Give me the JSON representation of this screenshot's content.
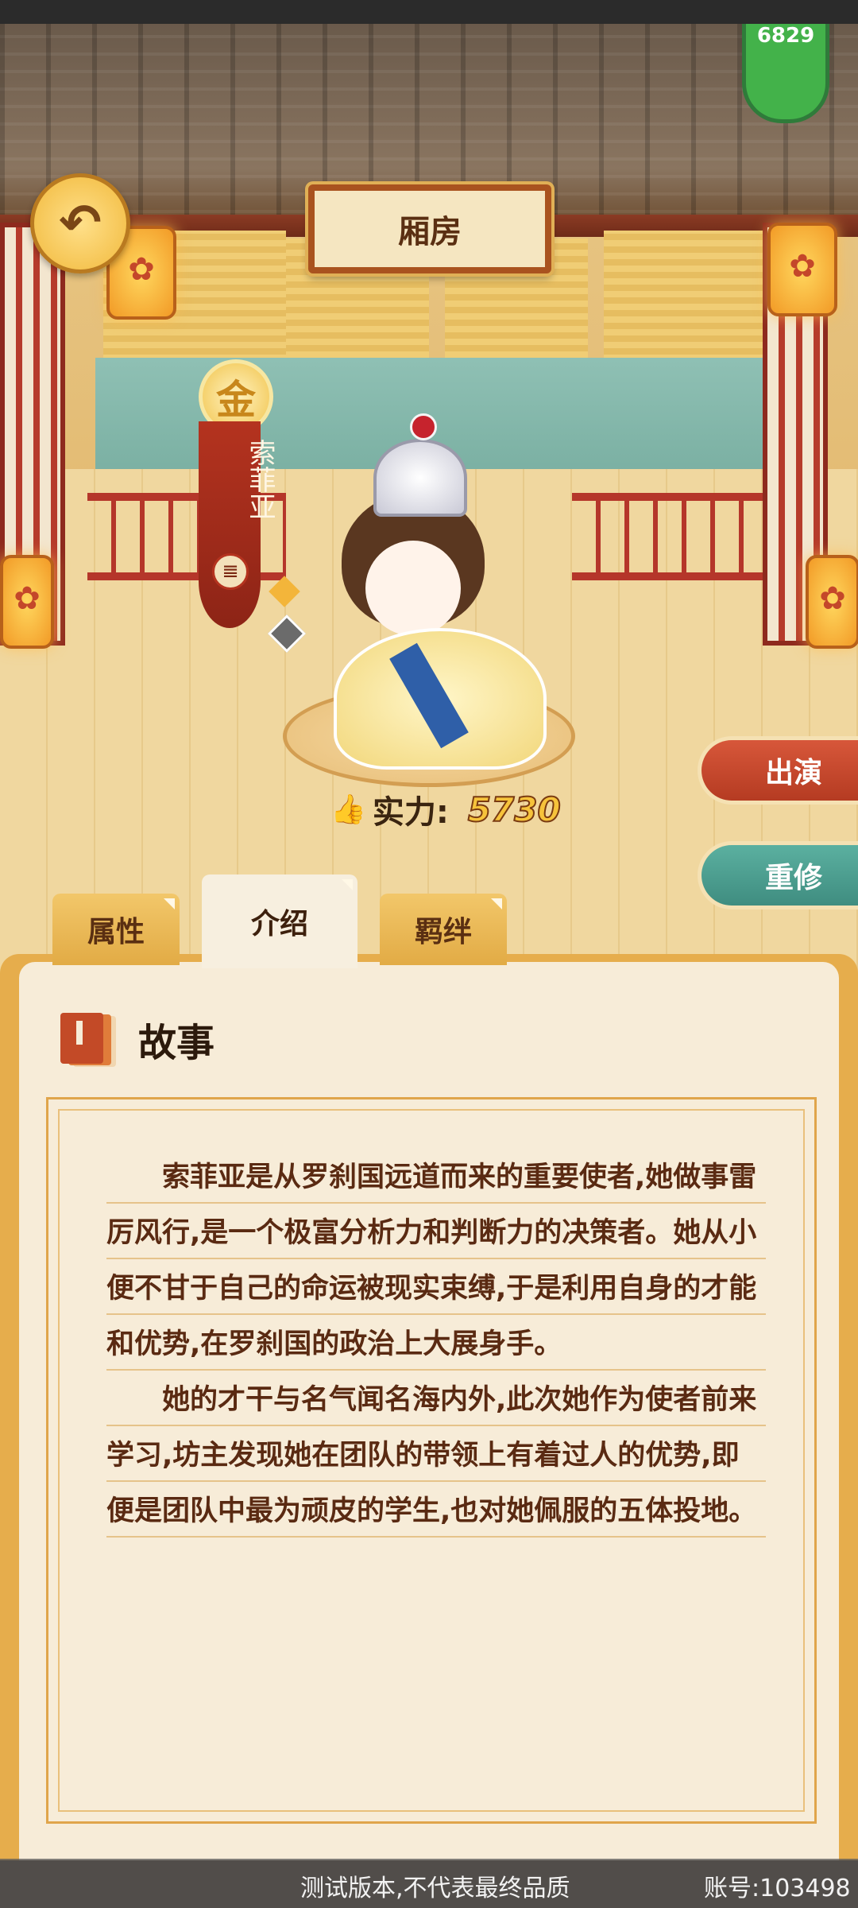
{
  "header": {
    "title": "厢房",
    "power_badge": "6829"
  },
  "character": {
    "grade": "金",
    "name": "索菲亚",
    "emblem": "𝌆",
    "power_label": "实力:",
    "power_value": "5730"
  },
  "actions": {
    "perform": "出演",
    "retrain": "重修"
  },
  "tabs": [
    {
      "label": "属性"
    },
    {
      "label": "介绍"
    },
    {
      "label": "羁绊"
    }
  ],
  "story": {
    "title": "故事",
    "paragraphs": [
      "索菲亚是从罗刹国远道而来的重要使者,她做事雷厉风行,是一个极富分析力和判断力的决策者。她从小便不甘于自己的命运被现实束缚,于是利用自身的才能和优势,在罗刹国的政治上大展身手。",
      "她的才干与名气闻名海内外,此次她作为使者前来学习,坊主发现她在团队的带领上有着过人的优势,即便是团队中最为顽皮的学生,也对她佩服的五体投地。"
    ]
  },
  "footer": {
    "notice": "测试版本,不代表最终品质",
    "account": "账号:103498"
  },
  "icons": {
    "back": "back-arrow-icon",
    "story": "book-icon",
    "power": "thumbs-up-icon"
  },
  "colors": {
    "perform": "#c44a2c",
    "retrain": "#4f9e90",
    "accent": "#e6ad4c"
  }
}
